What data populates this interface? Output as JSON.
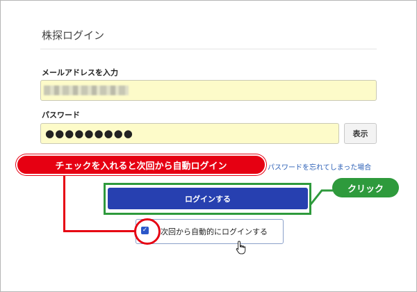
{
  "page": {
    "title": "株探ログイン"
  },
  "email": {
    "label": "メールアドレスを入力",
    "value": ""
  },
  "password": {
    "label": "パスワード",
    "masked_value": "●●●●●●●●●",
    "show_button": "表示"
  },
  "links": {
    "forgot_password": "パスワードを忘れてしまった場合"
  },
  "login_button": {
    "label": "ログインする"
  },
  "auto_login": {
    "label": "次回から自動的にログインする",
    "checked": true
  },
  "annotations": {
    "red_callout": "チェックを入れると次回から自動ログイン",
    "green_callout": "クリック"
  },
  "colors": {
    "accent_button": "#2740b0",
    "input_bg": "#fdfbc9",
    "callout_red": "#e60012",
    "callout_green": "#2e9a3c",
    "link": "#2b5fb6"
  },
  "icons": {
    "checkbox": "check-icon",
    "cursor": "hand-pointer-icon"
  }
}
